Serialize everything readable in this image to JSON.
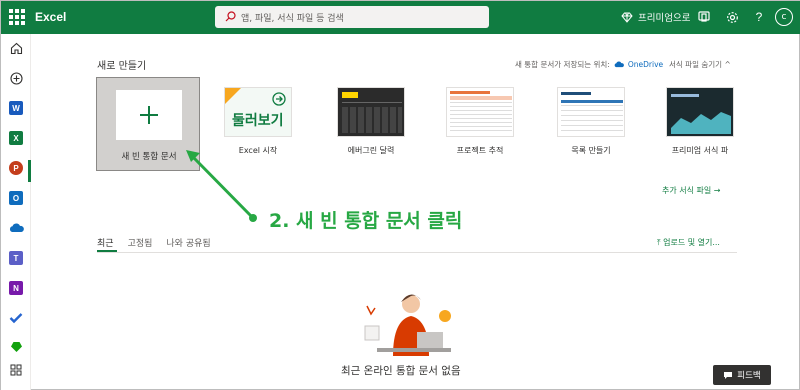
{
  "header": {
    "app_title": "Excel",
    "search_placeholder": "앱, 파일, 서식 파일 등 검색",
    "premium_label": "프리미엄으로"
  },
  "new_section": {
    "title": "새로 만들기",
    "save_location_label": "새 통합 문서가 저장되는 위치:",
    "save_location_value": "OneDrive",
    "hide_templates_label": "서식 파일 숨기기 ^",
    "more_templates_label": "추가 서식 파일 →",
    "blank_label": "새 빈 통합 문서",
    "templates": [
      {
        "label": "Excel 시작",
        "thumb_text": "둘러보기"
      },
      {
        "label": "에버그린 달력"
      },
      {
        "label": "프로젝트 추적"
      },
      {
        "label": "목록 만들기"
      },
      {
        "label": "프리미엄 서식 파"
      }
    ]
  },
  "annotation": "2. 새 빈 통합 문서 클릭",
  "recent": {
    "tabs": [
      "최근",
      "고정됨",
      "나와 공유됨"
    ],
    "upload_label": "업로드 및 열기...",
    "empty_text": "최근 온라인 통합 문서 없음"
  },
  "feedback_label": "피드백",
  "colors": {
    "brand": "#107c41",
    "annotation": "#27a844"
  }
}
